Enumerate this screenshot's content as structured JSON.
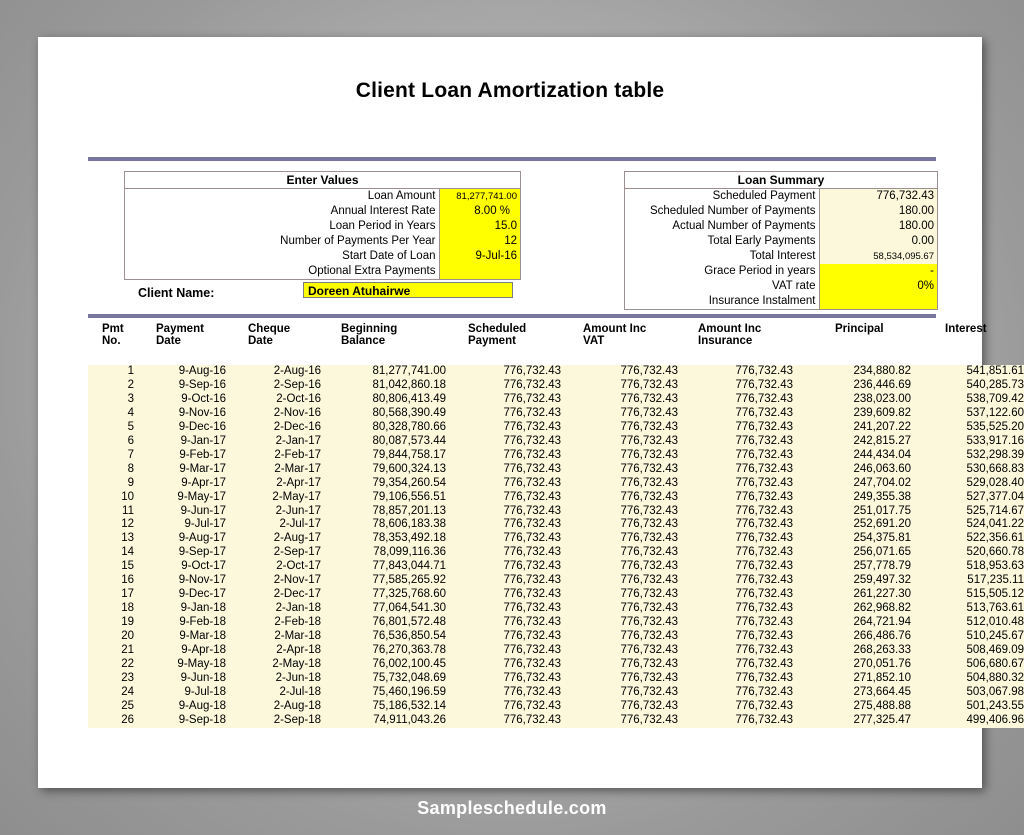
{
  "document": {
    "title": "Client Loan Amortization table",
    "footer_watermark": "Sampleschedule.com"
  },
  "colors": {
    "input_yellow": "#ffff00",
    "result_cream": "#fbf8dc",
    "rule_purple": "#76769e",
    "panel_border": "#9c8f8f"
  },
  "enter_values": {
    "header": "Enter Values",
    "rows": [
      {
        "label": "Loan Amount",
        "value": "81,277,741.00"
      },
      {
        "label": "Annual Interest Rate",
        "value": "8.00  %"
      },
      {
        "label": "Loan Period in Years",
        "value": "15.0"
      },
      {
        "label": "Number of Payments Per Year",
        "value": "12"
      },
      {
        "label": "Start Date of Loan",
        "value": "9-Jul-16"
      },
      {
        "label": "Optional Extra Payments",
        "value": ""
      }
    ]
  },
  "loan_summary": {
    "header": "Loan Summary",
    "rows": [
      {
        "label": "Scheduled Payment",
        "value": "776,732.43",
        "fill": "cream"
      },
      {
        "label": "Scheduled Number of Payments",
        "value": "180.00",
        "fill": "cream"
      },
      {
        "label": "Actual Number of Payments",
        "value": "180.00",
        "fill": "cream"
      },
      {
        "label": "Total Early Payments",
        "value": "0.00",
        "fill": "cream"
      },
      {
        "label": "Total Interest",
        "value": "58,534,095.67",
        "fill": "cream"
      },
      {
        "label": "Grace Period in years",
        "value": "-",
        "fill": "yellow"
      },
      {
        "label": "VAT rate",
        "value": "0%",
        "fill": "yellow"
      },
      {
        "label": "Insurance Instalment",
        "value": "",
        "fill": "yellow"
      }
    ]
  },
  "client": {
    "label": "Client Name:",
    "name": "Doreen Atuhairwe"
  },
  "table": {
    "columns": [
      {
        "line1": "Pmt",
        "line2": "No."
      },
      {
        "line1": "Payment",
        "line2": "Date"
      },
      {
        "line1": "Cheque",
        "line2": "Date"
      },
      {
        "line1": "Beginning",
        "line2": "Balance"
      },
      {
        "line1": "Scheduled",
        "line2": "Payment"
      },
      {
        "line1": "Amount Inc",
        "line2": "VAT"
      },
      {
        "line1": "Amount Inc",
        "line2": "Insurance"
      },
      {
        "line1": "Principal",
        "line2": ""
      },
      {
        "line1": "Interest",
        "line2": ""
      }
    ],
    "rows": [
      [
        "1",
        "9-Aug-16",
        "2-Aug-16",
        "81,277,741.00",
        "776,732.43",
        "776,732.43",
        "776,732.43",
        "234,880.82",
        "541,851.61"
      ],
      [
        "2",
        "9-Sep-16",
        "2-Sep-16",
        "81,042,860.18",
        "776,732.43",
        "776,732.43",
        "776,732.43",
        "236,446.69",
        "540,285.73"
      ],
      [
        "3",
        "9-Oct-16",
        "2-Oct-16",
        "80,806,413.49",
        "776,732.43",
        "776,732.43",
        "776,732.43",
        "238,023.00",
        "538,709.42"
      ],
      [
        "4",
        "9-Nov-16",
        "2-Nov-16",
        "80,568,390.49",
        "776,732.43",
        "776,732.43",
        "776,732.43",
        "239,609.82",
        "537,122.60"
      ],
      [
        "5",
        "9-Dec-16",
        "2-Dec-16",
        "80,328,780.66",
        "776,732.43",
        "776,732.43",
        "776,732.43",
        "241,207.22",
        "535,525.20"
      ],
      [
        "6",
        "9-Jan-17",
        "2-Jan-17",
        "80,087,573.44",
        "776,732.43",
        "776,732.43",
        "776,732.43",
        "242,815.27",
        "533,917.16"
      ],
      [
        "7",
        "9-Feb-17",
        "2-Feb-17",
        "79,844,758.17",
        "776,732.43",
        "776,732.43",
        "776,732.43",
        "244,434.04",
        "532,298.39"
      ],
      [
        "8",
        "9-Mar-17",
        "2-Mar-17",
        "79,600,324.13",
        "776,732.43",
        "776,732.43",
        "776,732.43",
        "246,063.60",
        "530,668.83"
      ],
      [
        "9",
        "9-Apr-17",
        "2-Apr-17",
        "79,354,260.54",
        "776,732.43",
        "776,732.43",
        "776,732.43",
        "247,704.02",
        "529,028.40"
      ],
      [
        "10",
        "9-May-17",
        "2-May-17",
        "79,106,556.51",
        "776,732.43",
        "776,732.43",
        "776,732.43",
        "249,355.38",
        "527,377.04"
      ],
      [
        "11",
        "9-Jun-17",
        "2-Jun-17",
        "78,857,201.13",
        "776,732.43",
        "776,732.43",
        "776,732.43",
        "251,017.75",
        "525,714.67"
      ],
      [
        "12",
        "9-Jul-17",
        "2-Jul-17",
        "78,606,183.38",
        "776,732.43",
        "776,732.43",
        "776,732.43",
        "252,691.20",
        "524,041.22"
      ],
      [
        "13",
        "9-Aug-17",
        "2-Aug-17",
        "78,353,492.18",
        "776,732.43",
        "776,732.43",
        "776,732.43",
        "254,375.81",
        "522,356.61"
      ],
      [
        "14",
        "9-Sep-17",
        "2-Sep-17",
        "78,099,116.36",
        "776,732.43",
        "776,732.43",
        "776,732.43",
        "256,071.65",
        "520,660.78"
      ],
      [
        "15",
        "9-Oct-17",
        "2-Oct-17",
        "77,843,044.71",
        "776,732.43",
        "776,732.43",
        "776,732.43",
        "257,778.79",
        "518,953.63"
      ],
      [
        "16",
        "9-Nov-17",
        "2-Nov-17",
        "77,585,265.92",
        "776,732.43",
        "776,732.43",
        "776,732.43",
        "259,497.32",
        "517,235.11"
      ],
      [
        "17",
        "9-Dec-17",
        "2-Dec-17",
        "77,325,768.60",
        "776,732.43",
        "776,732.43",
        "776,732.43",
        "261,227.30",
        "515,505.12"
      ],
      [
        "18",
        "9-Jan-18",
        "2-Jan-18",
        "77,064,541.30",
        "776,732.43",
        "776,732.43",
        "776,732.43",
        "262,968.82",
        "513,763.61"
      ],
      [
        "19",
        "9-Feb-18",
        "2-Feb-18",
        "76,801,572.48",
        "776,732.43",
        "776,732.43",
        "776,732.43",
        "264,721.94",
        "512,010.48"
      ],
      [
        "20",
        "9-Mar-18",
        "2-Mar-18",
        "76,536,850.54",
        "776,732.43",
        "776,732.43",
        "776,732.43",
        "266,486.76",
        "510,245.67"
      ],
      [
        "21",
        "9-Apr-18",
        "2-Apr-18",
        "76,270,363.78",
        "776,732.43",
        "776,732.43",
        "776,732.43",
        "268,263.33",
        "508,469.09"
      ],
      [
        "22",
        "9-May-18",
        "2-May-18",
        "76,002,100.45",
        "776,732.43",
        "776,732.43",
        "776,732.43",
        "270,051.76",
        "506,680.67"
      ],
      [
        "23",
        "9-Jun-18",
        "2-Jun-18",
        "75,732,048.69",
        "776,732.43",
        "776,732.43",
        "776,732.43",
        "271,852.10",
        "504,880.32"
      ],
      [
        "24",
        "9-Jul-18",
        "2-Jul-18",
        "75,460,196.59",
        "776,732.43",
        "776,732.43",
        "776,732.43",
        "273,664.45",
        "503,067.98"
      ],
      [
        "25",
        "9-Aug-18",
        "2-Aug-18",
        "75,186,532.14",
        "776,732.43",
        "776,732.43",
        "776,732.43",
        "275,488.88",
        "501,243.55"
      ],
      [
        "26",
        "9-Sep-18",
        "2-Sep-18",
        "74,911,043.26",
        "776,732.43",
        "776,732.43",
        "776,732.43",
        "277,325.47",
        "499,406.96"
      ]
    ]
  }
}
